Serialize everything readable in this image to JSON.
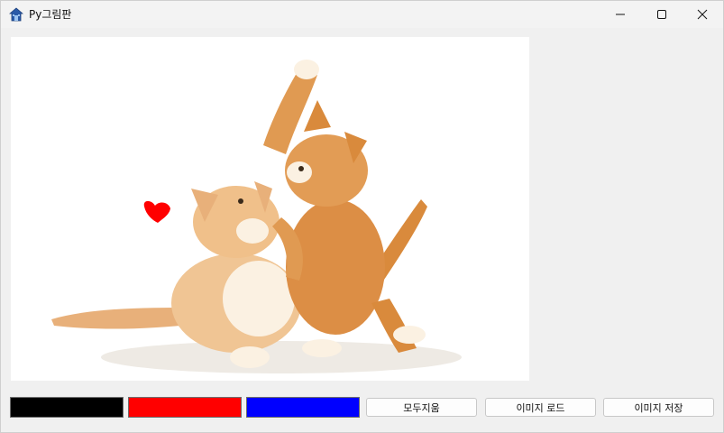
{
  "window": {
    "title": "Py그림판"
  },
  "title_icon": "home-icon",
  "controls": {
    "minimize_icon": "minimize-icon",
    "maximize_icon": "maximize-icon",
    "close_icon": "close-icon"
  },
  "canvas": {
    "image_description": "two orange kittens playing"
  },
  "palette": [
    {
      "name": "black",
      "color": "#000000"
    },
    {
      "name": "red",
      "color": "#ff0000"
    },
    {
      "name": "blue",
      "color": "#0000ff"
    }
  ],
  "buttons": {
    "clear_label": "모두지움",
    "load_label": "이미지 로드",
    "save_label": "이미지 저장"
  }
}
